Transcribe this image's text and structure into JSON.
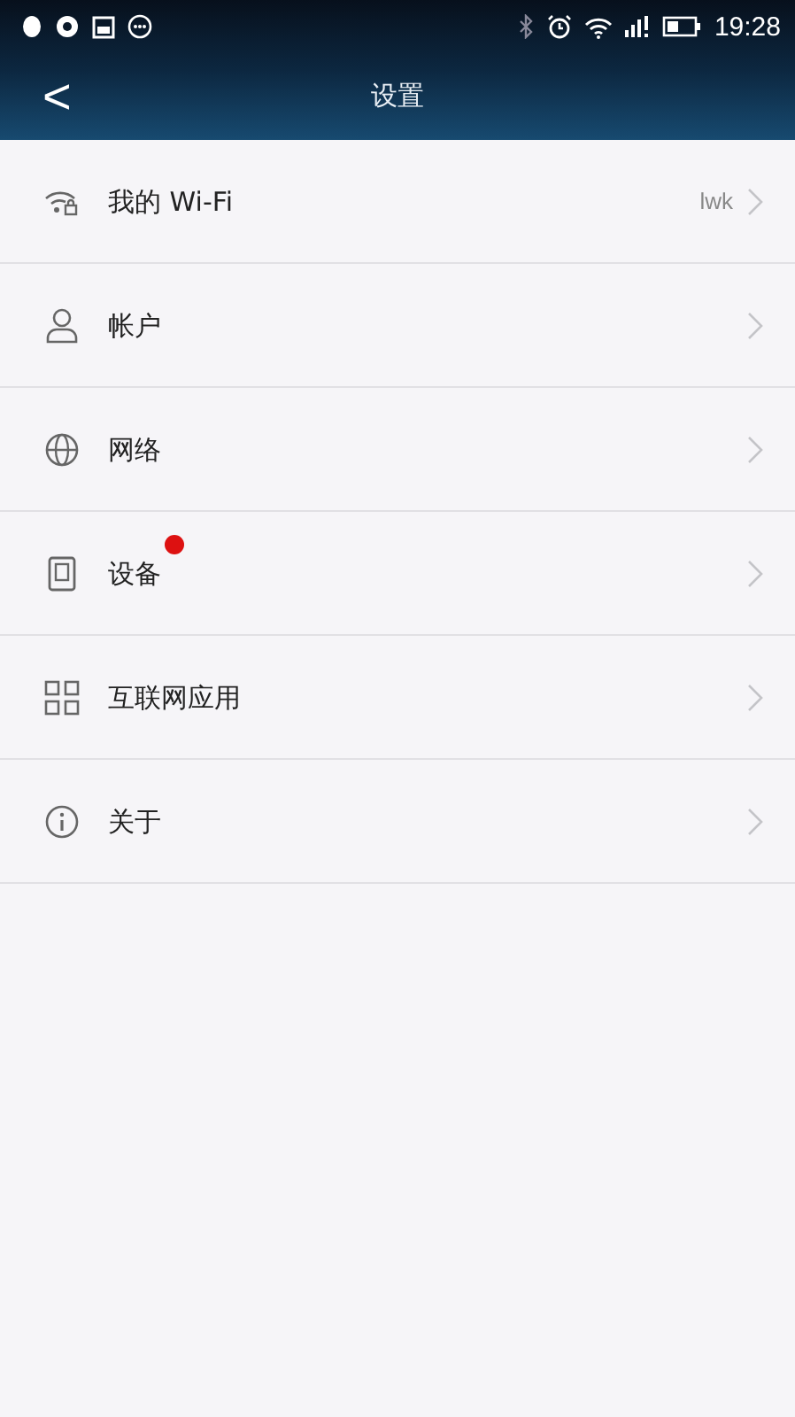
{
  "status_bar": {
    "time": "19:28"
  },
  "header": {
    "back": "<",
    "title": "设置"
  },
  "items": [
    {
      "kind": "wifi",
      "label": "我的 Wi-Fi",
      "value": "lwk",
      "badge": false
    },
    {
      "kind": "account",
      "label": "帐户",
      "badge": false
    },
    {
      "kind": "network",
      "label": "网络",
      "badge": false
    },
    {
      "kind": "device",
      "label": "设备",
      "badge": true
    },
    {
      "kind": "apps",
      "label": "互联网应用",
      "badge": false
    },
    {
      "kind": "about",
      "label": "关于",
      "badge": false
    }
  ]
}
